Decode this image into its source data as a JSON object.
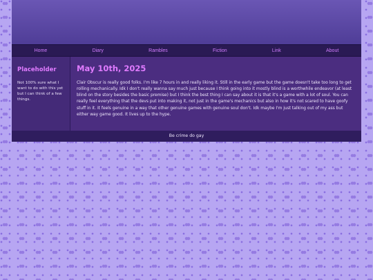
{
  "nav": {
    "items": [
      {
        "label": "Home"
      },
      {
        "label": "Diary"
      },
      {
        "label": "Rambles"
      },
      {
        "label": "Fiction"
      },
      {
        "label": "Link"
      },
      {
        "label": "About"
      }
    ]
  },
  "sidebar": {
    "title": "Placeholder",
    "text": "Not 100% sure what I want to do with this yet but I can think of a few things."
  },
  "post": {
    "date": "May 10th, 2025",
    "body": "Clair Obscur is really good folks. I'm like 7 hours in and really liking it. Still in the early game but the game doesn't take too long to get rolling mechanically. Idk I don't really wanna say much just because I think going into it mostly blind is a worthwhile endeavor (at least blind on the story besides the basic premise) but I think the best thing I can say about it is that it's a game with a lot of soul. You can really feel everything that the devs put into making it, not just in the game's mechanics but also in how it's not scared to have goofy stuff in it. It feels genuine in a way that other genuine games with genuine soul don't. Idk maybe I'm just talking out of my ass but either way game good. It lives up to the hype."
  },
  "footer": {
    "text": "Be crime do gay"
  },
  "colors": {
    "accent": "#e07bff",
    "nav_link": "#d27cff",
    "panel": "#4b2d80",
    "background": "#b7a6f2"
  }
}
